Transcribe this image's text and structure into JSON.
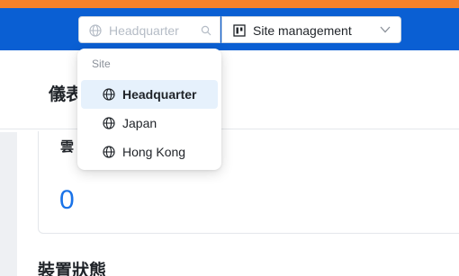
{
  "header": {
    "site_selector": {
      "placeholder": "Headquarter",
      "icon": "globe-icon",
      "search_icon": "search-icon"
    },
    "module_selector": {
      "label": "Site management",
      "icon": "board-icon",
      "chevron": "chevron-down-icon"
    },
    "colors": {
      "accent_stripe": "#f5822a",
      "header_bg": "#0a5fd3"
    }
  },
  "dropdown": {
    "group_label": "Site",
    "options": [
      {
        "label": "Headquarter",
        "icon": "globe-icon",
        "selected": true
      },
      {
        "label": "Japan",
        "icon": "globe-icon",
        "selected": false
      },
      {
        "label": "Hong Kong",
        "icon": "globe-icon",
        "selected": false
      }
    ]
  },
  "main": {
    "page_title": "儀表",
    "card": {
      "title": "雲",
      "value": "0"
    },
    "section_title": "裝置狀態"
  }
}
